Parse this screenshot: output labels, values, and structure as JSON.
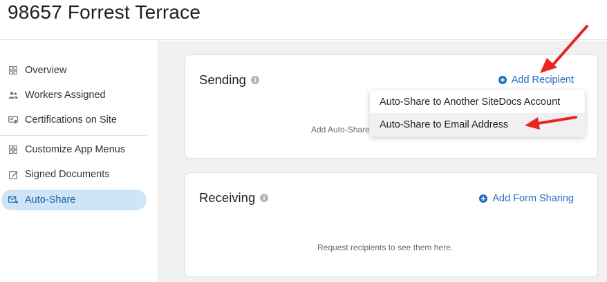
{
  "page": {
    "title": "98657 Forrest Terrace"
  },
  "sidebar": {
    "items": [
      {
        "label": "Overview",
        "icon": "grid-icon",
        "active": false
      },
      {
        "label": "Workers Assigned",
        "icon": "people-icon",
        "active": false
      },
      {
        "label": "Certifications on Site",
        "icon": "certificate-icon",
        "active": false
      },
      {
        "label": "Customize App Menus",
        "icon": "grid-icon",
        "active": false
      },
      {
        "label": "Signed Documents",
        "icon": "pencil-edit-icon",
        "active": false
      },
      {
        "label": "Auto-Share",
        "icon": "mail-forward-icon",
        "active": true
      }
    ]
  },
  "sending": {
    "title": "Sending",
    "action_label": "Add Recipient",
    "empty_text": "Add Auto-Share"
  },
  "receiving": {
    "title": "Receiving",
    "action_label": "Add Form Sharing",
    "empty_text": "Request recipients to see them here."
  },
  "dropdown": {
    "items": [
      {
        "label": "Auto-Share to Another SiteDocs Account"
      },
      {
        "label": "Auto-Share to Email Address",
        "highlighted": true
      }
    ]
  },
  "colors": {
    "accent": "#1f6cc2",
    "active_bg": "#cfe4f7",
    "annotation_arrow": "#e8251f"
  }
}
